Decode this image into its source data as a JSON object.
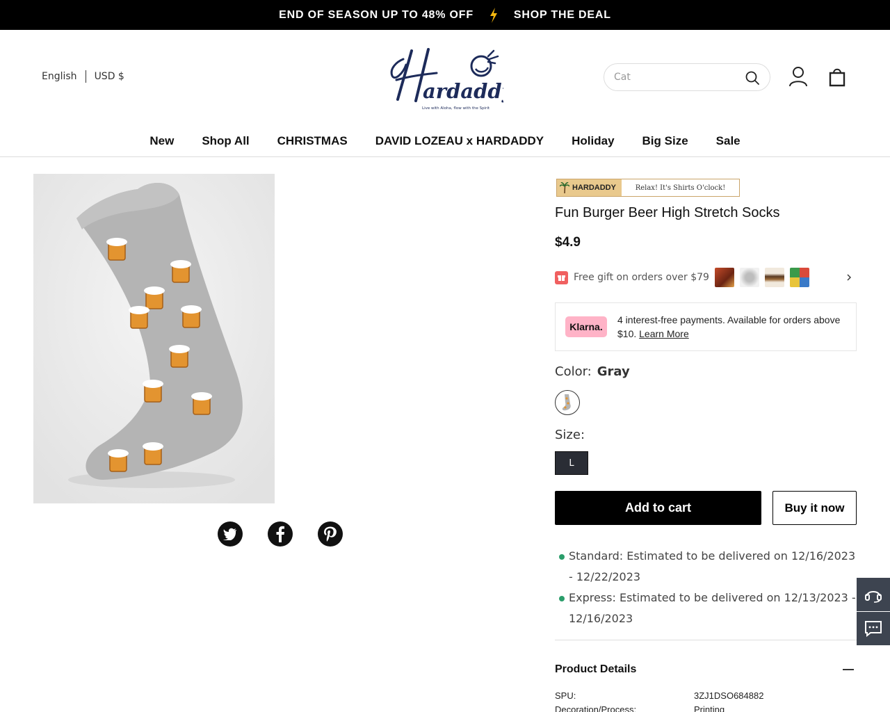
{
  "promo": {
    "left_text": "END OF SEASON UP TO 48% OFF",
    "right_text": "SHOP THE DEAL",
    "bolt_color": "#f5b80f"
  },
  "header": {
    "language": "English",
    "currency": "USD $",
    "logo_text": "Hardaddy",
    "logo_tagline": "Live with Aloha, flow with the Spirit",
    "search_value": "Cat",
    "icons": [
      "search-icon",
      "user-icon",
      "cart-icon"
    ]
  },
  "nav": {
    "items": [
      "New",
      "Shop All",
      "CHRISTMAS",
      "DAVID LOZEAU x HARDADDY",
      "Holiday",
      "Big Size",
      "Sale"
    ]
  },
  "product": {
    "banner_brand": "HARDADDY",
    "banner_slogan": "Relax! It's Shirts O'clock!",
    "title": "Fun Burger Beer High Stretch Socks",
    "price": "$4.9",
    "gift_text": "Free gift on orders over $79",
    "klarna_badge": "Klarna.",
    "klarna_text": "4 interest-free payments. Available for orders above $10.",
    "klarna_link": "Learn More",
    "color_label": "Color:",
    "color_value": "Gray",
    "size_label": "Size:",
    "size_value": "L",
    "add_to_cart": "Add to cart",
    "buy_now": "Buy it now"
  },
  "delivery": [
    "Standard: Estimated to be delivered on 12/16/2023 - 12/22/2023",
    "Express: Estimated to be delivered on 12/13/2023 - 12/16/2023"
  ],
  "details": {
    "title": "Product Details",
    "specs": [
      {
        "key": "SPU:",
        "value": "3ZJ1DSO684882"
      },
      {
        "key": "Decoration/Process:",
        "value": "Printing"
      }
    ]
  },
  "colors": {
    "accent": "#000000",
    "brand_navy": "#1d2b5a",
    "gift_red": "#f06060",
    "klarna_pink": "#ffb3c7",
    "delivery_dot": "#2a9d6a"
  }
}
